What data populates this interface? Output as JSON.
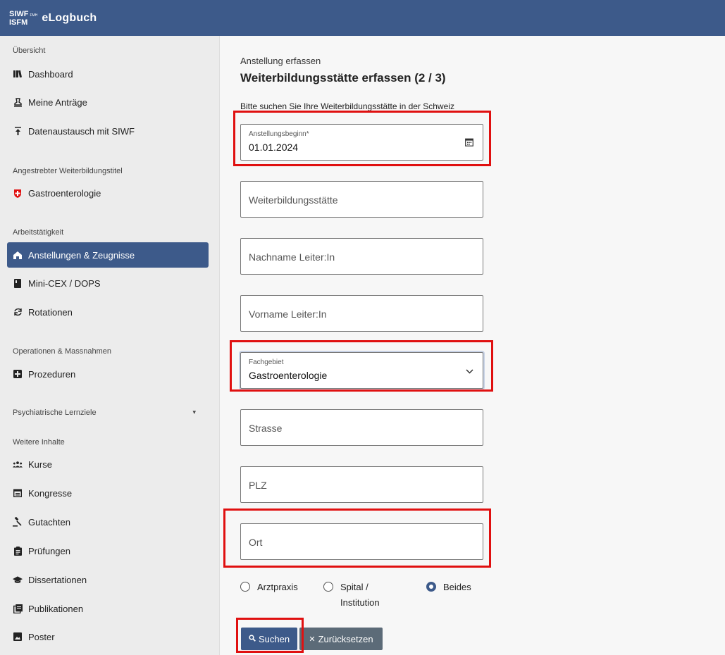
{
  "header": {
    "logo_line1": "SIWF",
    "logo_line2": "ISFM",
    "logo_small": "FMH",
    "app_title": "eLogbuch"
  },
  "sidebar": {
    "section_overview": "Übersicht",
    "dashboard": "Dashboard",
    "meine_antraege": "Meine Anträge",
    "datenaustausch": "Datenaustausch mit SIWF",
    "section_title": "Angestrebter Weiterbildungstitel",
    "gastro": "Gastroenterologie",
    "section_work": "Arbeitstätigkeit",
    "anstellungen": "Anstellungen & Zeugnisse",
    "minicex": "Mini-CEX / DOPS",
    "rotationen": "Rotationen",
    "section_ops": "Operationen & Massnahmen",
    "prozeduren": "Prozeduren",
    "section_psych": "Psychiatrische Lernziele",
    "section_more": "Weitere Inhalte",
    "kurse": "Kurse",
    "kongresse": "Kongresse",
    "gutachten": "Gutachten",
    "pruefungen": "Prüfungen",
    "dissertationen": "Dissertationen",
    "publikationen": "Publikationen",
    "poster": "Poster"
  },
  "main": {
    "kicker": "Anstellung erfassen",
    "heading": "Weiterbildungsstätte erfassen (2 / 3)",
    "hint": "Bitte suchen Sie Ihre Weiterbildungsstätte in der Schweiz",
    "anstellungsbeginn_label": "Anstellungsbeginn*",
    "anstellungsbeginn_value": "01.01.2024",
    "weiterbildungsstaette_placeholder": "Weiterbildungsstätte",
    "nachname_placeholder": "Nachname Leiter:In",
    "vorname_placeholder": "Vorname Leiter:In",
    "fachgebiet_label": "Fachgebiet",
    "fachgebiet_value": "Gastroenterologie",
    "strasse_placeholder": "Strasse",
    "plz_placeholder": "PLZ",
    "ort_placeholder": "Ort",
    "radio_arztpraxis": "Arztpraxis",
    "radio_spital_1": "Spital /",
    "radio_spital_2": "Institution",
    "radio_beides": "Beides",
    "radio_selected": "Beides",
    "btn_suchen": "Suchen",
    "btn_zuruecksetzen": "Zurücksetzen"
  },
  "colors": {
    "brand": "#3d5a8a",
    "highlight": "#e01010",
    "secondary_button": "#5c6b78"
  },
  "icons": {
    "dashboard": "bar-chart-icon",
    "antraege": "stamp-icon",
    "datenaustausch": "upload-icon",
    "gastro": "swiss-cross-icon",
    "anstellungen": "house-icon",
    "minicex": "book-icon",
    "rotationen": "rotate-icon",
    "prozeduren": "plus-box-icon",
    "kurse": "group-icon",
    "kongresse": "calendar-list-icon",
    "gutachten": "gavel-icon",
    "pruefungen": "clipboard-icon",
    "dissertationen": "graduation-cap-icon",
    "publikationen": "documents-icon",
    "poster": "image-icon",
    "calendar": "calendar-icon",
    "chevron": "chevron-down-icon",
    "search": "search-icon",
    "close": "close-icon"
  }
}
